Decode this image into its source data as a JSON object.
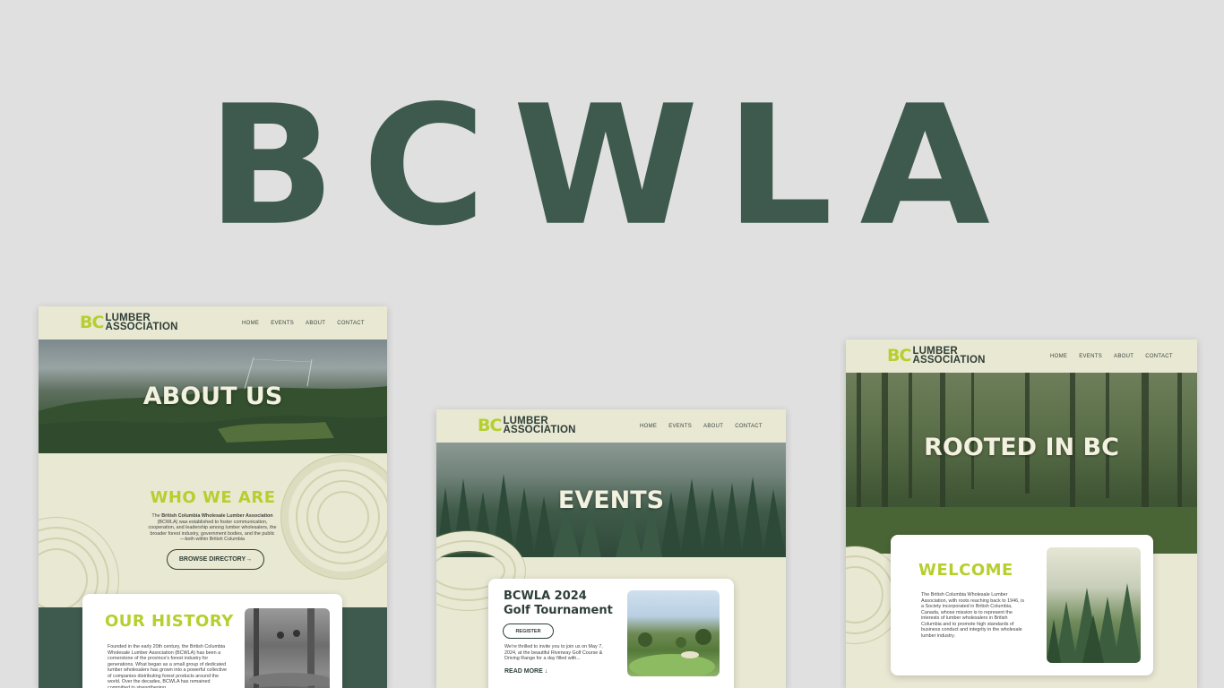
{
  "hero": {
    "title": "BCWLA"
  },
  "brand": {
    "bc": "BC",
    "line1": "LUMBER",
    "line2": "ASSOCIATION"
  },
  "nav": {
    "home": "HOME",
    "events": "EVENTS",
    "about": "ABOUT",
    "contact": "CONTACT"
  },
  "about_page": {
    "banner_title": "ABOUT US",
    "who_title": "WHO WE ARE",
    "who_text_bold": "British Columbia Wholesale Lumber Association",
    "who_text_pre": "The ",
    "who_text_post": " (BCWLA) was established to foster communication, cooperation, and leadership among lumber wholesalers, the broader forest industry, government bodies, and the public—both within British Columbia",
    "browse_label": "BROWSE DIRECTORY→",
    "history_title": "OUR HISTORY",
    "history_text": "Founded in the early 20th century, the British Columbia Wholesale Lumber Association (BCWLA) has been a cornerstone of the province's forest industry for generations. What began as a small group of dedicated lumber wholesalers has grown into a powerful collective of companies distributing forest products around the world. Over the decades, BCWLA has remained committed to strengthening"
  },
  "events_page": {
    "banner_title": "EVENTS",
    "event_title_1": "BCWLA 2024",
    "event_title_2": "Golf Tournament",
    "register_label": "REGISTER",
    "event_text": "We're thrilled to invite you to join us on May 7, 2024, at the beautiful Riverway Golf Course & Driving Range for a day filled with...",
    "read_more": "READ MORE ↓"
  },
  "home_page": {
    "banner_title": "ROOTED IN BC",
    "welcome_title": "WELCOME",
    "welcome_text": "The British Columbia Wholesale Lumber Association, with roots reaching back to 1946, is a Society incorporated in British Columbia, Canada, whose mission is to represent the interests of lumber wholesalers in British Columbia and to promote high standards of business conduct and integrity in the wholesale lumber industry."
  },
  "colors": {
    "brand_green": "#3e5a4e",
    "accent_lime": "#b6cf2d",
    "cream": "#e9e8d3"
  }
}
